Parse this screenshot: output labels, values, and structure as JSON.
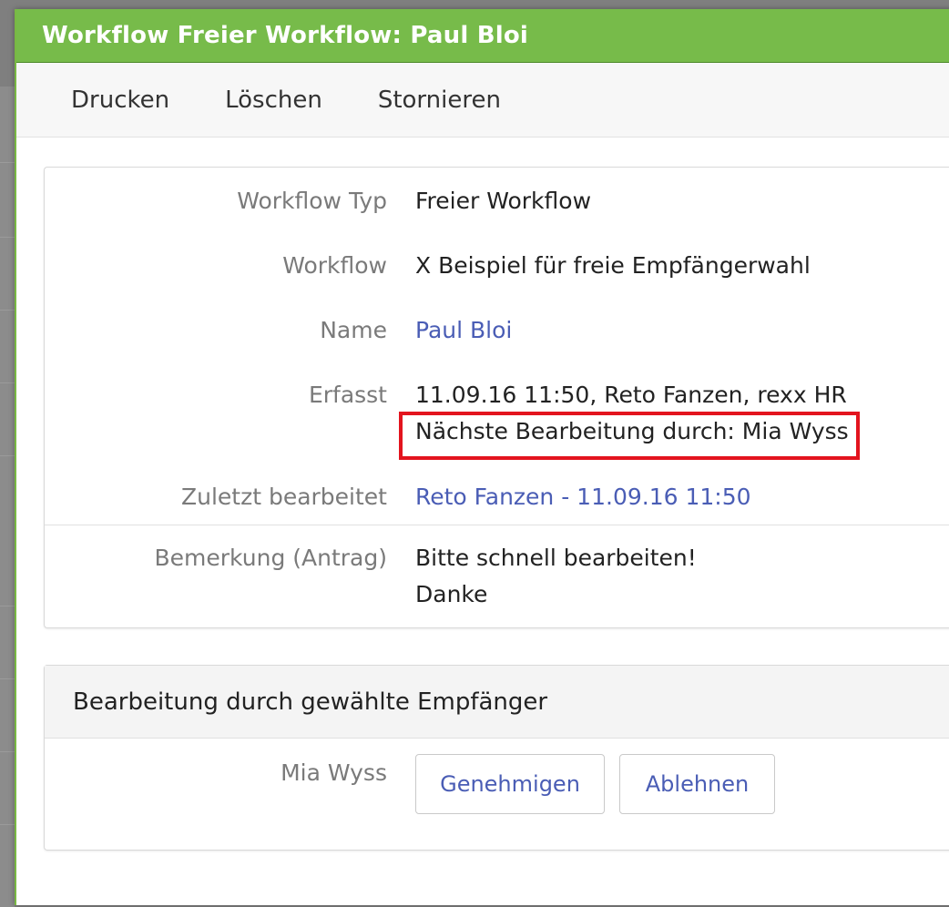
{
  "dialog": {
    "title": "Workflow Freier Workflow: Paul Bloi"
  },
  "toolbar": {
    "print_label": "Drucken",
    "delete_label": "Löschen",
    "cancel_label": "Stornieren"
  },
  "info": {
    "workflow_type_label": "Workflow Typ",
    "workflow_type_value": "Freier Workflow",
    "workflow_label": "Workflow",
    "workflow_value": "X Beispiel für freie Empfängerwahl",
    "name_label": "Name",
    "name_value": "Paul Bloi",
    "created_label": "Erfasst",
    "created_value": "11.09.16 11:50, Reto Fanzen, rexx HR",
    "next_processing": "Nächste Bearbeitung durch: Mia Wyss",
    "last_edited_label": "Zuletzt bearbeitet",
    "last_edited_value": "Reto Fanzen - 11.09.16 11:50",
    "remark_label": "Bemerkung (Antrag)",
    "remark_line1": "Bitte schnell bearbeiten!",
    "remark_line2": "Danke"
  },
  "recipients": {
    "header": "Bearbeitung durch gewählte Empfänger",
    "recipient_name": "Mia Wyss",
    "approve_label": "Genehmigen",
    "reject_label": "Ablehnen"
  },
  "colors": {
    "titlebar": "#77bb4a",
    "link": "#4a5db5",
    "highlight": "#e3141e"
  }
}
